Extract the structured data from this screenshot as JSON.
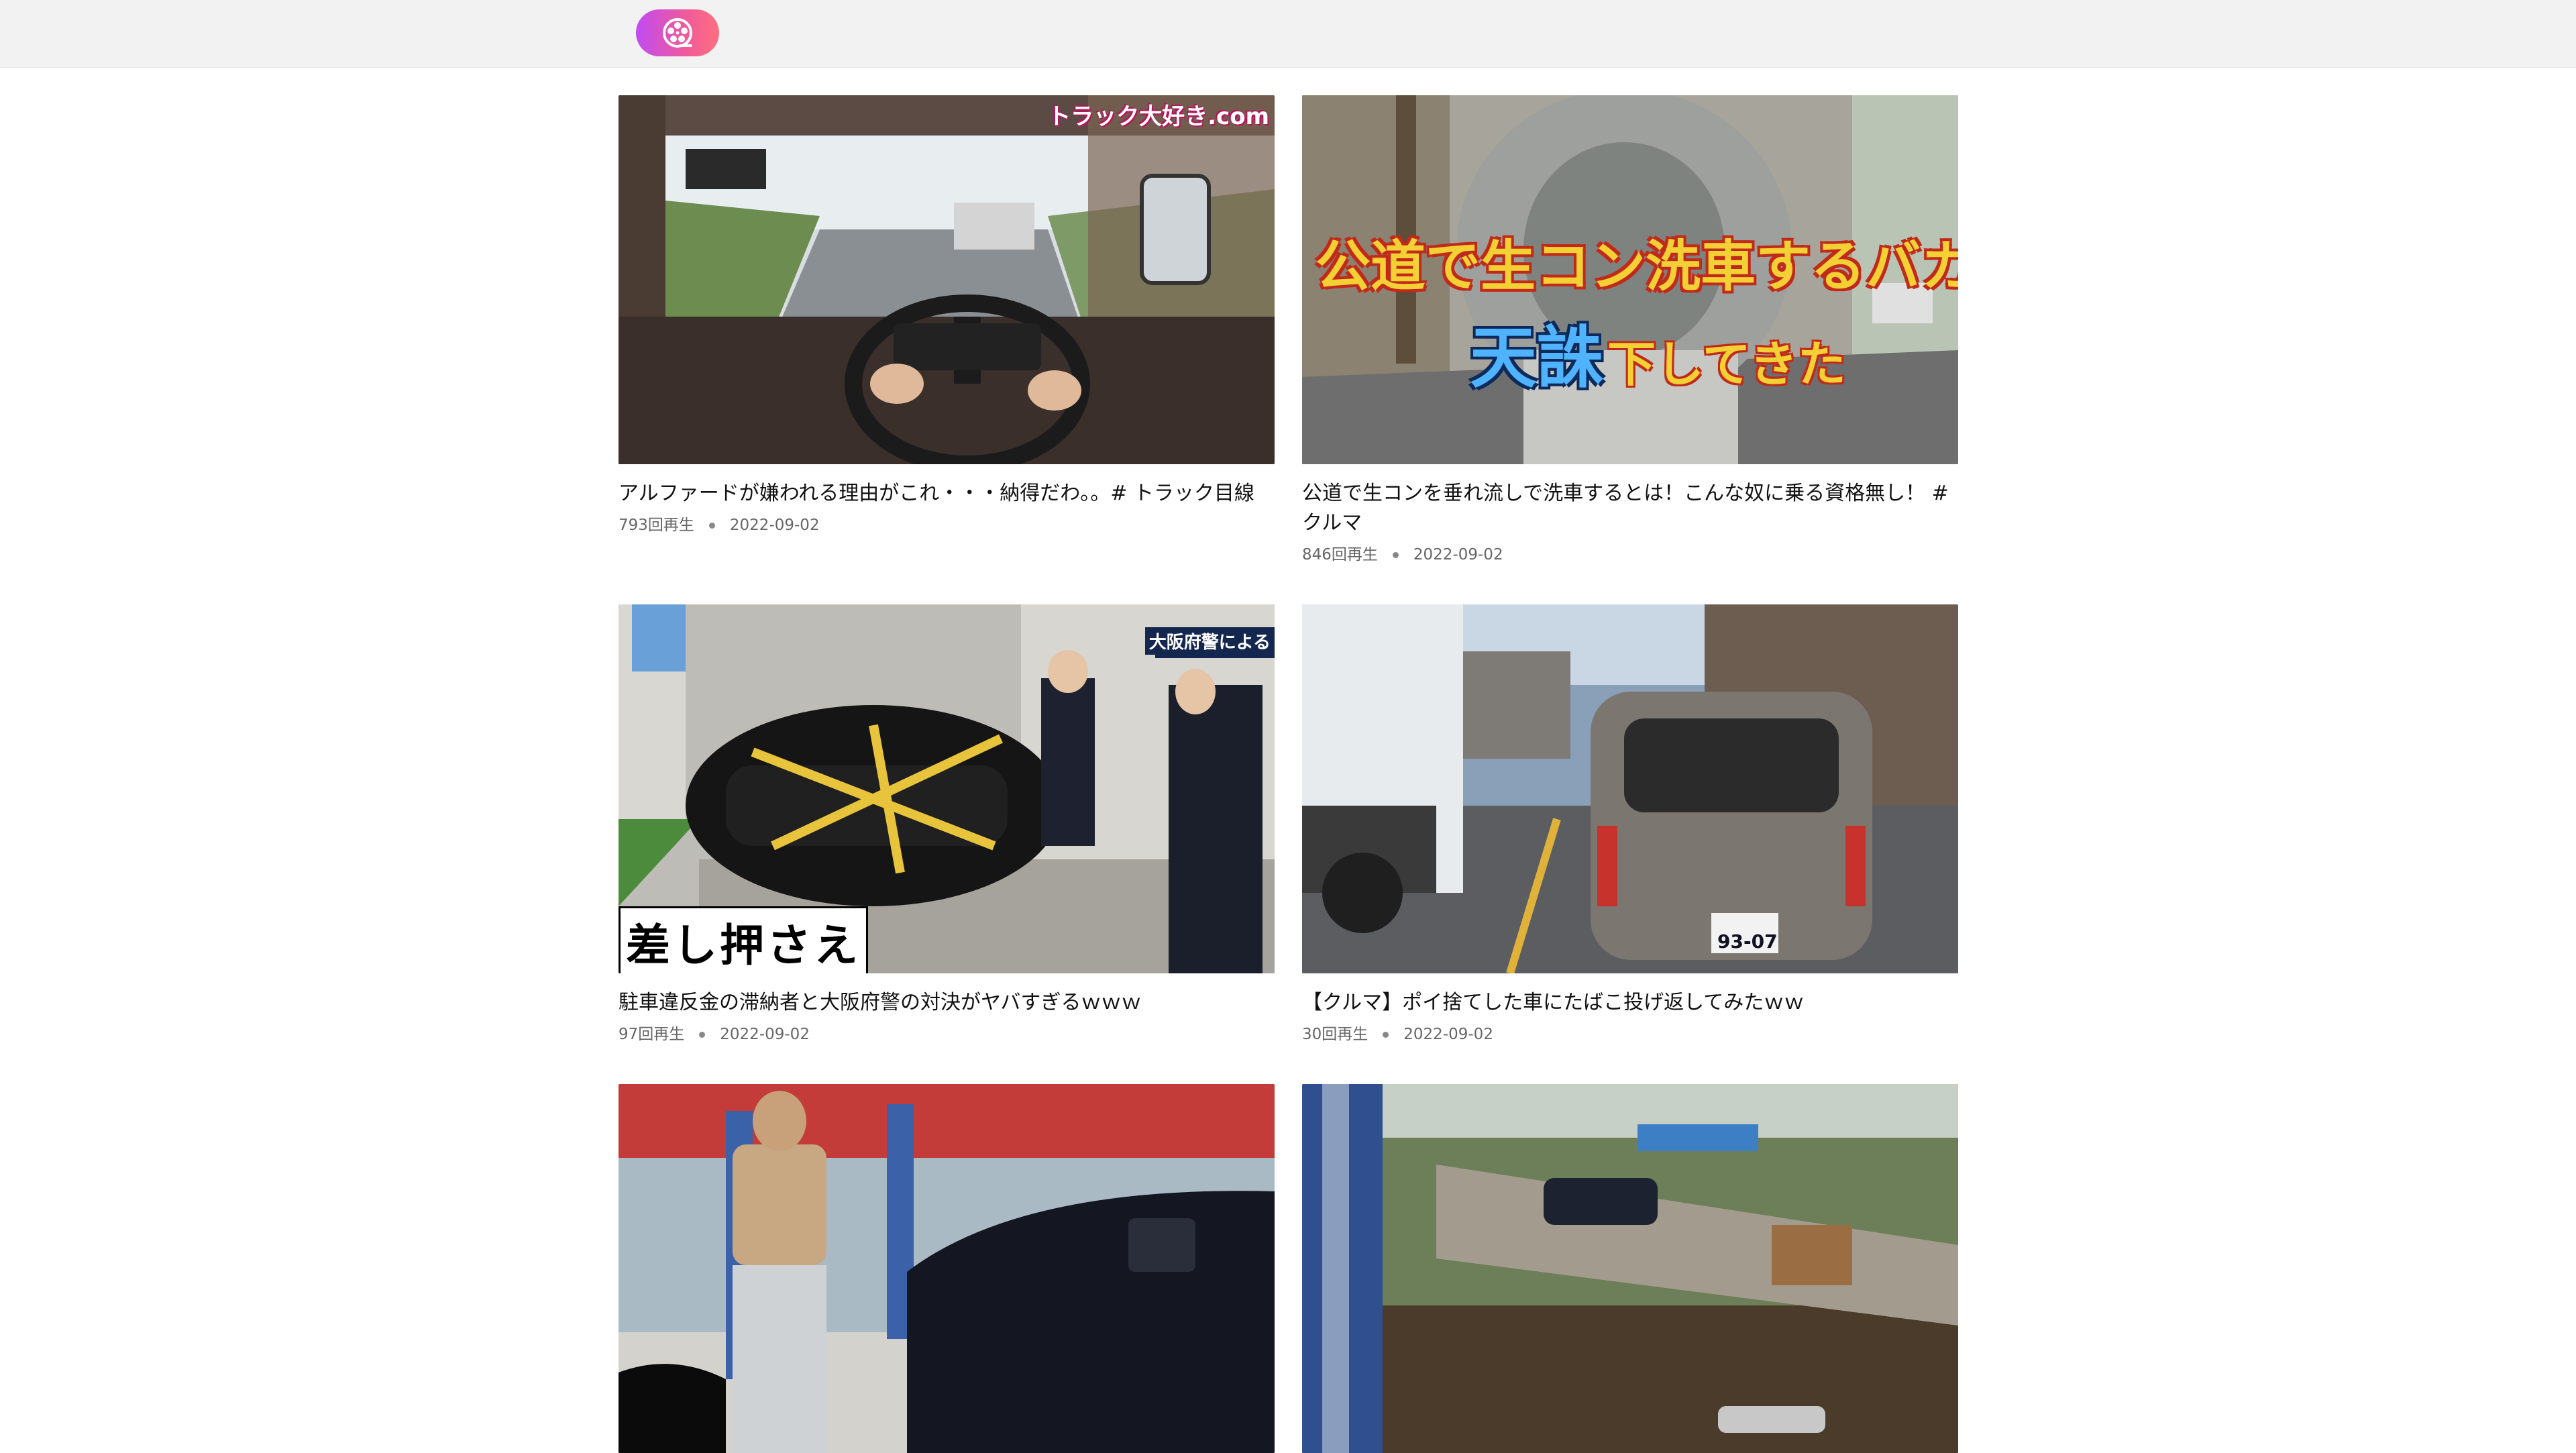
{
  "header": {
    "logo_icon": "film-reel-icon",
    "colors": {
      "background": "#f2f2f2",
      "logo_gradient": [
        "#c04bf2",
        "#ff6f7f"
      ]
    }
  },
  "videos": [
    {
      "title": "アルファードが嫌われる理由がこれ・・・納得だわ。。# トラック目線",
      "views": "793回再生",
      "date": "2022-09-02",
      "thumb_caption": "トラック大好き.com"
    },
    {
      "title": "公道で生コンを垂れ流しで洗車するとは！こんな奴に乗る資格無し！ #クルマ",
      "views": "846回再生",
      "date": "2022-09-02",
      "thumb_caption_line1": "公道で生コン洗車するバカに",
      "thumb_caption_line2_a": "天誅",
      "thumb_caption_line2_b": "下してきた"
    },
    {
      "title": "駐車違反金の滞納者と大阪府警の対決がヤバすぎるｗｗｗ",
      "views": "97回再生",
      "date": "2022-09-02",
      "thumb_caption_badge": "大阪府警による",
      "thumb_caption_bottom": "差し押さえ"
    },
    {
      "title": "【クルマ】ポイ捨てした車にたばこ投げ返してみたｗｗ",
      "views": "30回再生",
      "date": "2022-09-02",
      "thumb_plate": "93-07"
    },
    {
      "title": "",
      "views": "",
      "date": ""
    },
    {
      "title": "",
      "views": "",
      "date": ""
    }
  ]
}
